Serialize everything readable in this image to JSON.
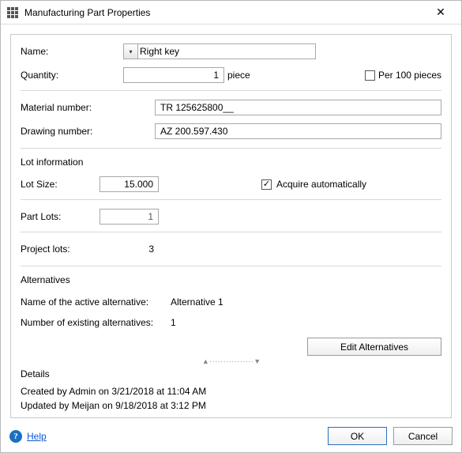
{
  "window": {
    "title": "Manufacturing Part Properties"
  },
  "fields": {
    "name_label": "Name:",
    "name_value": "Right key",
    "quantity_label": "Quantity:",
    "quantity_value": "1",
    "quantity_unit": "piece",
    "per100_label": "Per 100 pieces",
    "per100_checked": false,
    "material_label": "Material number:",
    "material_value": "TR 125625800__",
    "drawing_label": "Drawing number:",
    "drawing_value": "AZ 200.597.430"
  },
  "lot": {
    "section_title": "Lot information",
    "size_label": "Lot Size:",
    "size_value": "15.000",
    "acquire_label": "Acquire automatically",
    "acquire_checked": true,
    "part_lots_label": "Part Lots:",
    "part_lots_value": "1",
    "project_lots_label": "Project lots:",
    "project_lots_value": "3"
  },
  "alternatives": {
    "section_title": "Alternatives",
    "active_label": "Name of the active alternative:",
    "active_value": "Alternative 1",
    "count_label": "Number of existing alternatives:",
    "count_value": "1",
    "edit_button": "Edit Alternatives"
  },
  "details": {
    "section_title": "Details",
    "created": "Created by Admin on 3/21/2018 at 11:04 AM",
    "updated": "Updated by Meijan on 9/18/2018 at 3:12 PM"
  },
  "footer": {
    "help": "Help",
    "ok": "OK",
    "cancel": "Cancel"
  }
}
